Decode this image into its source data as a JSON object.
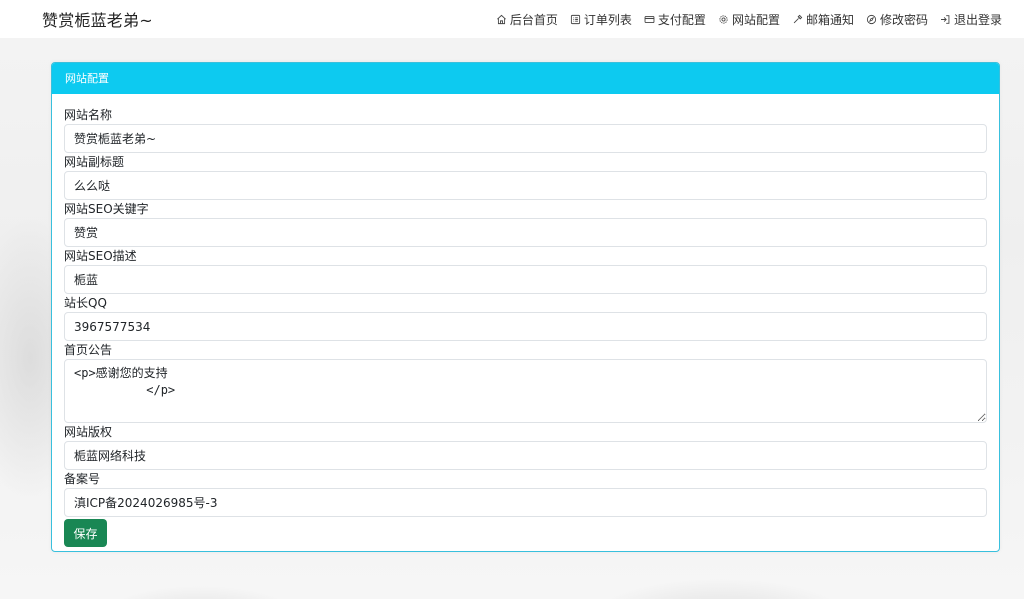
{
  "brand": "赞赏栀蓝老弟~",
  "nav": [
    {
      "icon": "home-icon",
      "label": "后台首页"
    },
    {
      "icon": "list-icon",
      "label": "订单列表"
    },
    {
      "icon": "card-icon",
      "label": "支付配置"
    },
    {
      "icon": "gear-icon",
      "label": "网站配置"
    },
    {
      "icon": "mail-icon",
      "label": "邮箱通知"
    },
    {
      "icon": "key-icon",
      "label": "修改密码"
    },
    {
      "icon": "logout-icon",
      "label": "退出登录"
    }
  ],
  "card": {
    "title": "网站配置",
    "fields": {
      "site_name": {
        "label": "网站名称",
        "value": "赞赏栀蓝老弟~"
      },
      "subtitle": {
        "label": "网站副标题",
        "value": "么么哒"
      },
      "seo_keywords": {
        "label": "网站SEO关键字",
        "value": "赞赏"
      },
      "seo_desc": {
        "label": "网站SEO描述",
        "value": "栀蓝"
      },
      "qq": {
        "label": "站长QQ",
        "value": "3967577534"
      },
      "notice": {
        "label": "首页公告",
        "value": "<p>感谢您的支持\n          </p>"
      },
      "copyright": {
        "label": "网站版权",
        "value": "栀蓝网络科技"
      },
      "icp": {
        "label": "备案号",
        "value": "滇ICP备2024026985号-3"
      }
    },
    "save_label": "保存"
  }
}
